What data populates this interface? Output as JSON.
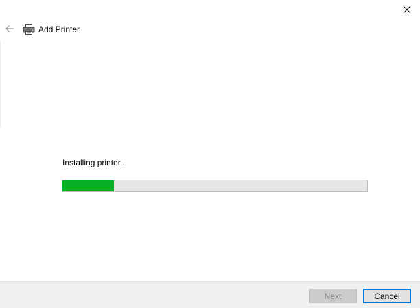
{
  "window": {
    "title": "Add Printer",
    "close_icon": "close-icon",
    "back_icon": "back-arrow-icon",
    "title_icon": "printer-icon"
  },
  "main": {
    "status_text": "Installing printer...",
    "progress_value": 0.17,
    "progress_color": "#06b025"
  },
  "footer": {
    "next_label": "Next",
    "next_enabled": false,
    "cancel_label": "Cancel",
    "accent_color": "#0078d7"
  }
}
